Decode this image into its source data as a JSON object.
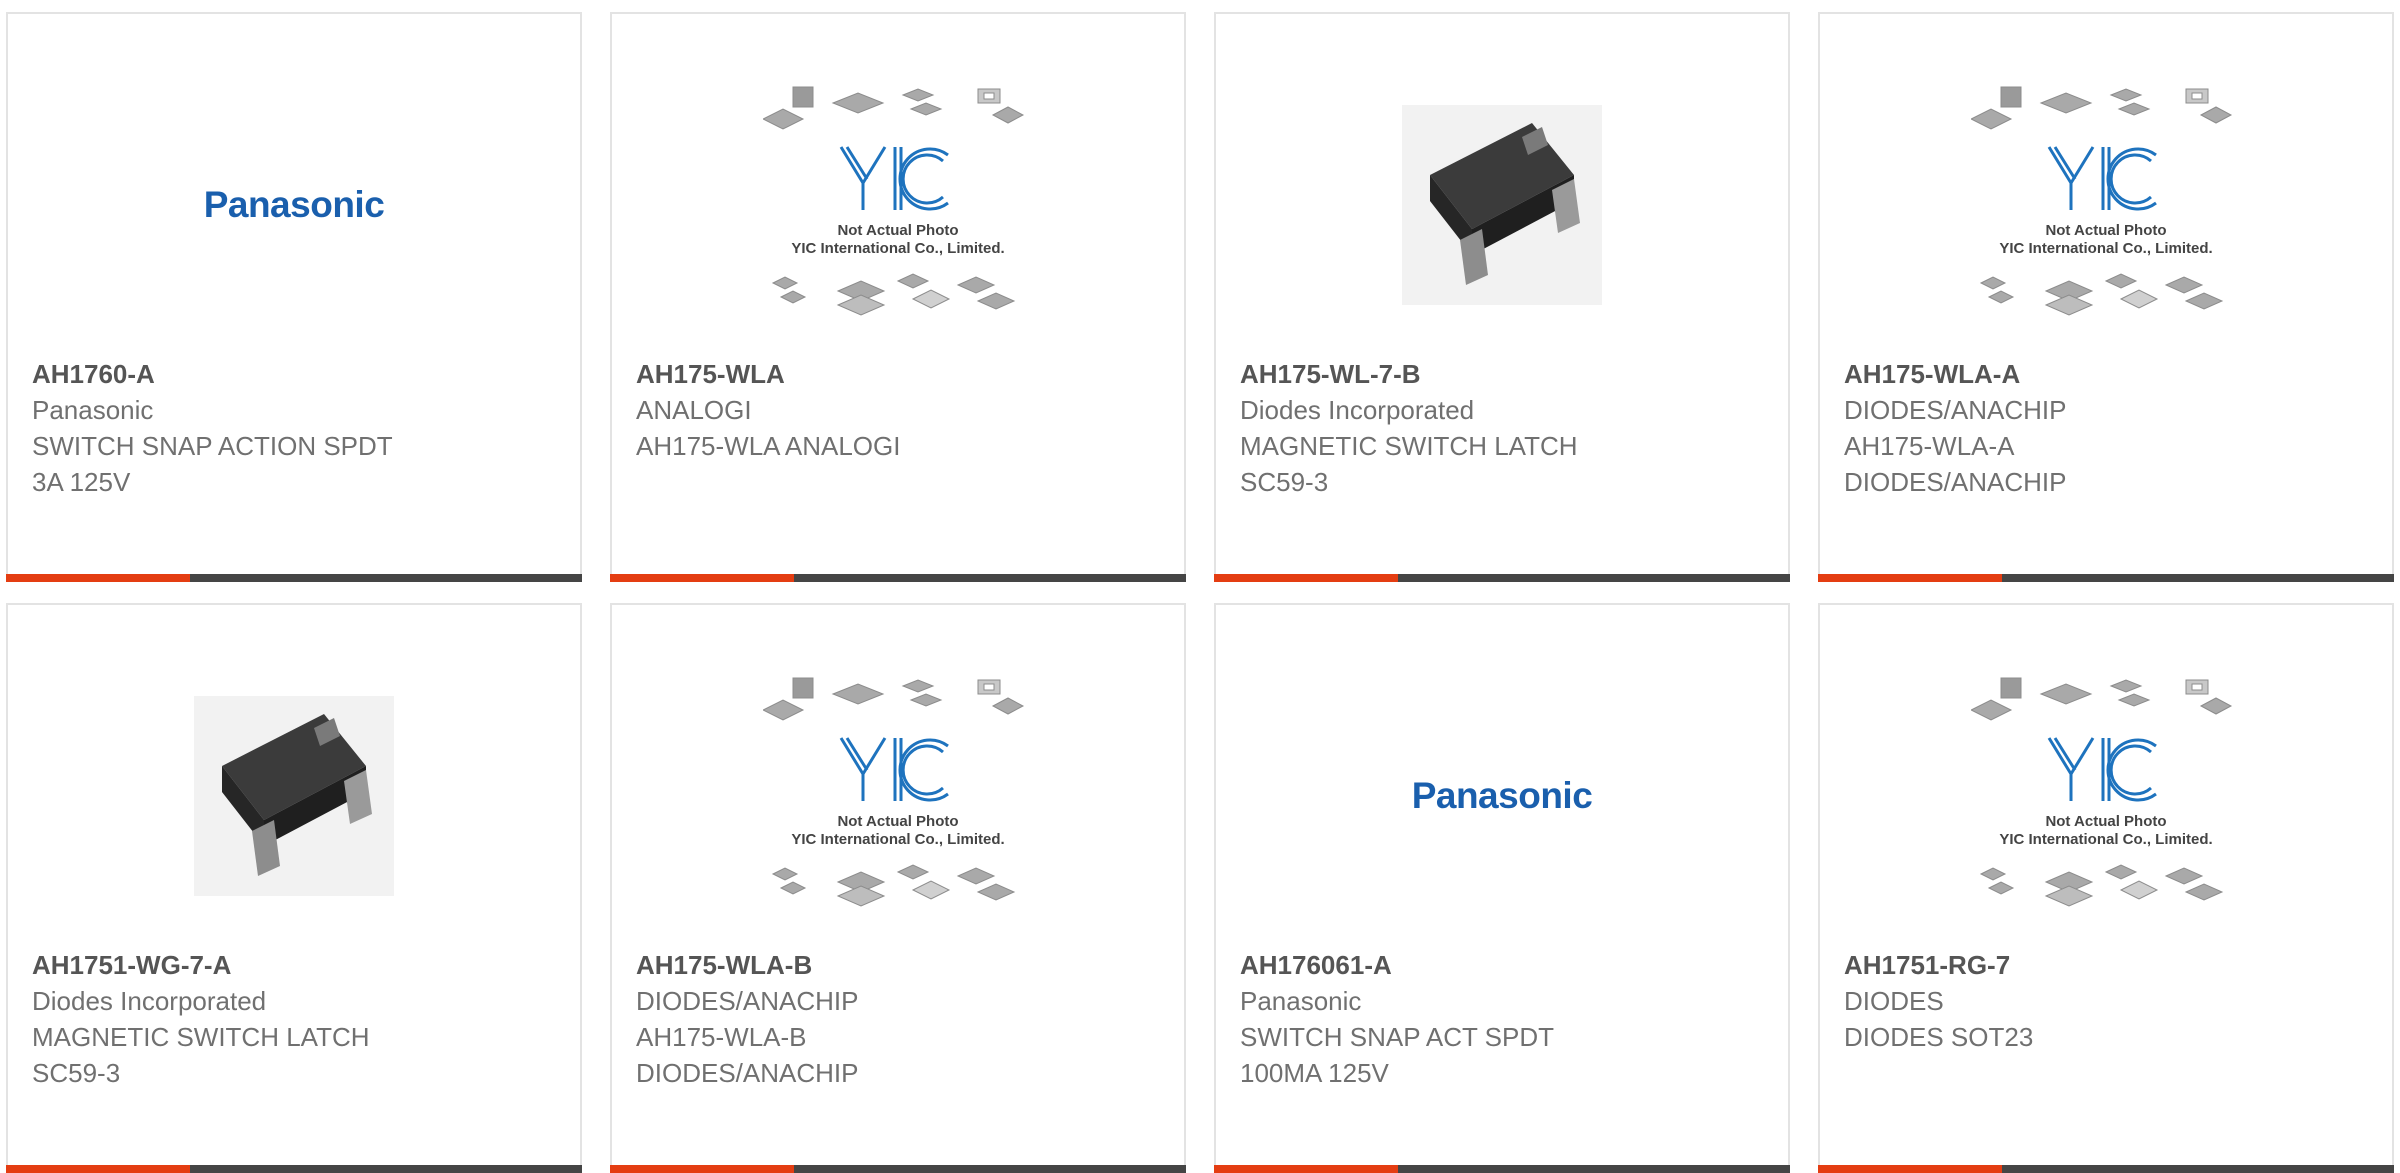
{
  "products": [
    {
      "part_no": "AH1760-A",
      "image_type": "logo",
      "logo_text": "Panasonic",
      "lines": [
        "Panasonic",
        "SWITCH SNAP ACTION SPDT",
        "3A 125V"
      ]
    },
    {
      "part_no": "AH175-WLA",
      "image_type": "placeholder",
      "lines": [
        "ANALOGI",
        "AH175-WLA ANALOGI"
      ]
    },
    {
      "part_no": "AH175-WL-7-B",
      "image_type": "chip-photo",
      "lines": [
        "Diodes Incorporated",
        "MAGNETIC SWITCH LATCH",
        "SC59-3"
      ]
    },
    {
      "part_no": "AH175-WLA-A",
      "image_type": "placeholder",
      "lines": [
        "DIODES/ANACHIP",
        "AH175-WLA-A",
        "DIODES/ANACHIP"
      ]
    },
    {
      "part_no": "AH1751-WG-7-A",
      "image_type": "chip-photo",
      "lines": [
        "Diodes Incorporated",
        "MAGNETIC SWITCH LATCH",
        "SC59-3"
      ]
    },
    {
      "part_no": "AH175-WLA-B",
      "image_type": "placeholder",
      "lines": [
        "DIODES/ANACHIP",
        "AH175-WLA-B",
        "DIODES/ANACHIP"
      ]
    },
    {
      "part_no": "AH176061-A",
      "image_type": "logo",
      "logo_text": "Panasonic",
      "lines": [
        "Panasonic",
        "SWITCH SNAP ACT SPDT",
        "100MA 125V"
      ]
    },
    {
      "part_no": "AH1751-RG-7",
      "image_type": "placeholder",
      "lines": [
        "DIODES",
        "DIODES SOT23"
      ]
    }
  ],
  "placeholder": {
    "logo": "YIC",
    "line1": "Not Actual Photo",
    "line2": "YIC International Co., Limited."
  },
  "colors": {
    "accent": "#e43d12",
    "bar": "#454545",
    "brand_blue": "#1a5fad",
    "yic_blue": "#1e73be"
  }
}
